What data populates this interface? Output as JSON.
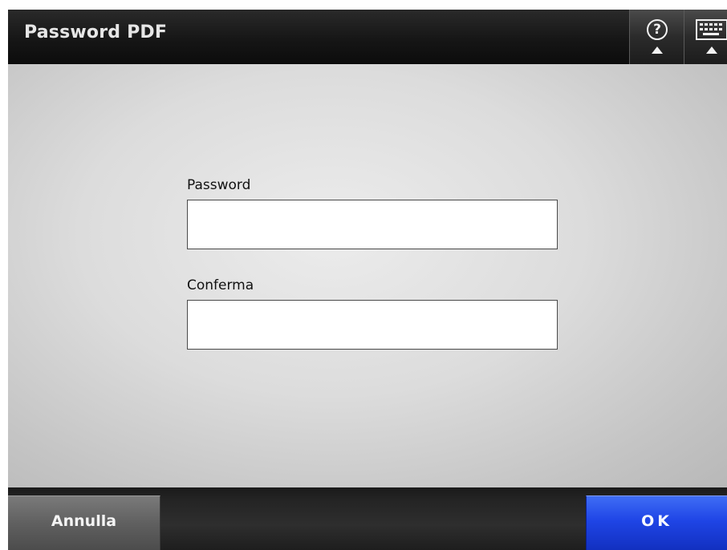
{
  "header": {
    "title": "Password PDF",
    "help_icon": "question-circle-icon",
    "help_glyph": "?",
    "keyboard_icon": "keyboard-icon"
  },
  "form": {
    "password_label": "Password",
    "password_value": "",
    "confirm_label": "Conferma",
    "confirm_value": ""
  },
  "footer": {
    "cancel_label": "Annulla",
    "ok_label": "OK"
  },
  "colors": {
    "title_bar": "#161616",
    "ok_button": "#1f45e6",
    "cancel_button": "#606060",
    "content_background": "#dcdcdc"
  }
}
